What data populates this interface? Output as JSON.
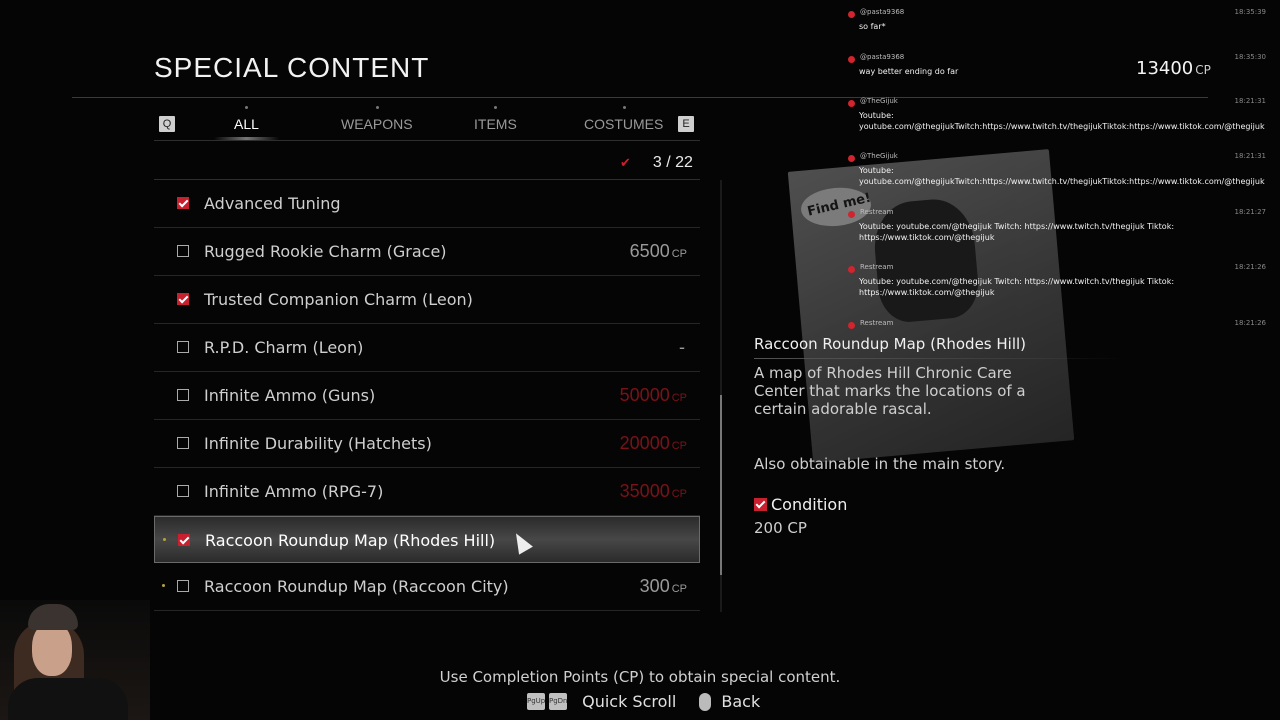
{
  "header": {
    "title": "SPECIAL CONTENT",
    "cp_total": "13400",
    "cp_unit": "CP"
  },
  "tabs": {
    "left_key": "Q",
    "right_key": "E",
    "items": [
      {
        "label": "ALL",
        "active": true
      },
      {
        "label": "WEAPONS",
        "active": false
      },
      {
        "label": "ITEMS",
        "active": false
      },
      {
        "label": "COSTUMES",
        "active": false
      }
    ]
  },
  "counter": {
    "icon": "checkmark-icon",
    "value": "3 / 22"
  },
  "items": [
    {
      "name": "Advanced Tuning",
      "checked": true,
      "price": "",
      "unit": ""
    },
    {
      "name": "Rugged Rookie Charm (Grace)",
      "checked": false,
      "price": "6500",
      "unit": "CP"
    },
    {
      "name": "Trusted Companion Charm (Leon)",
      "checked": true,
      "price": "",
      "unit": ""
    },
    {
      "name": "R.P.D. Charm (Leon)",
      "checked": false,
      "price": "-",
      "unit": ""
    },
    {
      "name": "Infinite Ammo (Guns)",
      "checked": false,
      "price": "50000",
      "unit": "CP"
    },
    {
      "name": "Infinite Durability (Hatchets)",
      "checked": false,
      "price": "20000",
      "unit": "CP"
    },
    {
      "name": "Infinite Ammo (RPG-7)",
      "checked": false,
      "price": "35000",
      "unit": "CP"
    },
    {
      "name": "Raccoon Roundup Map (Rhodes Hill)",
      "checked": true,
      "price": "",
      "unit": ""
    },
    {
      "name": "Raccoon Roundup Map (Raccoon City)",
      "checked": false,
      "price": "300",
      "unit": "CP"
    }
  ],
  "detail": {
    "title": "Raccoon Roundup Map (Rhodes Hill)",
    "description": "A map of Rhodes Hill Chronic Care Center that marks the locations of a certain adorable rascal.",
    "extra": "Also obtainable in the main story.",
    "condition_label": "Condition",
    "condition_cost": "200 CP",
    "poster_text": "Find me!"
  },
  "footer": {
    "hint": "Use Completion Points (CP) to obtain special content.",
    "key1": "PgUp",
    "key2": "PgDn",
    "quick_scroll": "Quick Scroll",
    "back": "Back"
  },
  "chat": [
    {
      "user": "@pasta9368",
      "time": "18:35:39",
      "text": "so far*"
    },
    {
      "user": "@pasta9368",
      "time": "18:35:30",
      "text": "way better ending do far"
    },
    {
      "user": "@TheGijuk",
      "time": "18:21:31",
      "text": "Youtube: youtube.com/@thegijukTwitch:https://www.twitch.tv/thegijukTiktok:https://www.tiktok.com/@thegijuk"
    },
    {
      "user": "@TheGijuk",
      "time": "18:21:31",
      "text": "Youtube: youtube.com/@thegijukTwitch:https://www.twitch.tv/thegijukTiktok:https://www.tiktok.com/@thegijuk"
    },
    {
      "user": "Restream",
      "time": "18:21:27",
      "text": "Youtube: youtube.com/@thegijuk Twitch: https://www.twitch.tv/thegijuk Tiktok: https://www.tiktok.com/@thegijuk"
    },
    {
      "user": "Restream",
      "time": "18:21:26",
      "text": "Youtube: youtube.com/@thegijuk Twitch: https://www.twitch.tv/thegijuk Tiktok: https://www.tiktok.com/@thegijuk"
    },
    {
      "user": "Restream",
      "time": "18:21:26",
      "text": ""
    }
  ]
}
